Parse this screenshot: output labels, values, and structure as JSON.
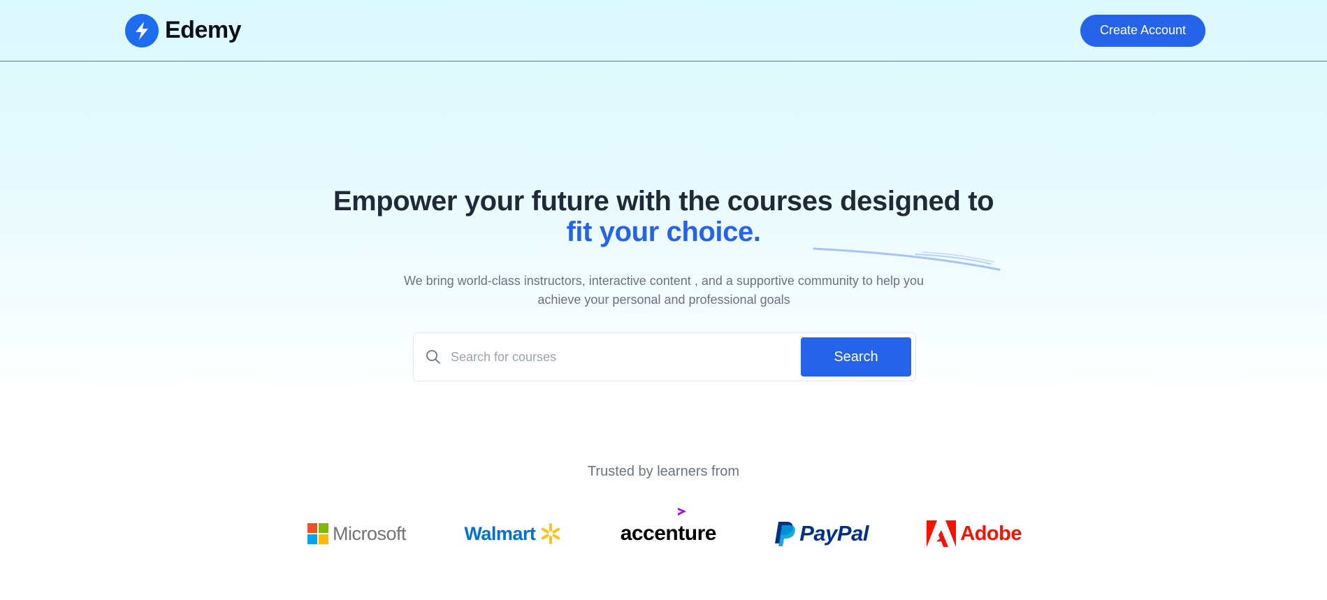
{
  "brand": {
    "name": "Edemy",
    "icon": "lightning-bolt-icon",
    "color": "#1d6cf0"
  },
  "nav": {
    "create_account_label": "Create Account"
  },
  "hero": {
    "headline_line1": "Empower your future with the courses designed to",
    "headline_accent": "fit your choice.",
    "subtitle": "We bring world-class instructors, interactive content , and a supportive community to help you achieve your personal and professional goals"
  },
  "search": {
    "placeholder": "Search for courses",
    "value": "",
    "button_label": "Search",
    "icon": "search-icon"
  },
  "trusted": {
    "label": "Trusted by learners from",
    "companies": [
      {
        "name": "Microsoft",
        "color": "#737373"
      },
      {
        "name": "Walmart",
        "color": "#0071ce"
      },
      {
        "name": "accenture",
        "color": "#000000"
      },
      {
        "name": "PayPal",
        "color": "#003087"
      },
      {
        "name": "Adobe",
        "color": "#fa0f00"
      }
    ]
  },
  "colors": {
    "accent": "#2563eb",
    "heading": "#1f2937",
    "muted": "#6b7280"
  }
}
